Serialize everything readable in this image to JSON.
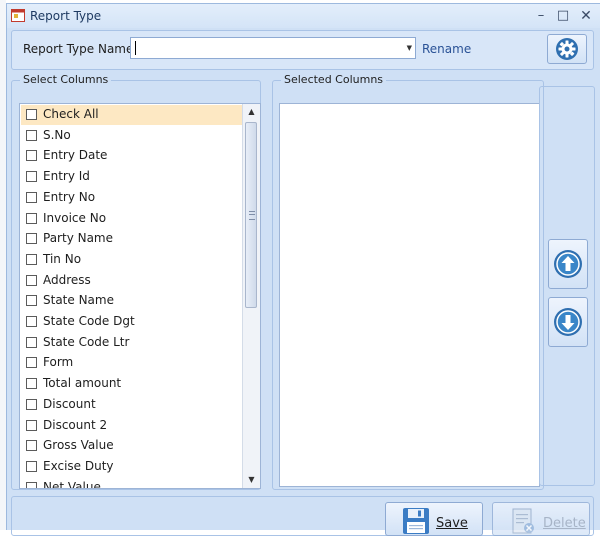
{
  "window": {
    "title": "Report Type"
  },
  "toolbar": {
    "report_type_label": "Report Type Name",
    "report_type_value": "",
    "rename_label": "Rename"
  },
  "icons": {
    "app": "app-window-icon",
    "settings": "gear-icon",
    "up": "arrow-up-circle-icon",
    "down": "arrow-down-circle-icon",
    "save": "floppy-disk-icon",
    "delete": "delete-document-icon"
  },
  "select_columns": {
    "title": "Select Columns",
    "items": [
      {
        "label": "Check All",
        "checked": false,
        "highlighted": true
      },
      {
        "label": "S.No",
        "checked": false
      },
      {
        "label": "Entry Date",
        "checked": false
      },
      {
        "label": "Entry Id",
        "checked": false
      },
      {
        "label": "Entry No",
        "checked": false
      },
      {
        "label": "Invoice No",
        "checked": false
      },
      {
        "label": "Party Name",
        "checked": false
      },
      {
        "label": "Tin No",
        "checked": false
      },
      {
        "label": "Address",
        "checked": false
      },
      {
        "label": "State Name",
        "checked": false
      },
      {
        "label": "State Code Dgt",
        "checked": false
      },
      {
        "label": "State Code Ltr",
        "checked": false
      },
      {
        "label": "Form",
        "checked": false
      },
      {
        "label": "Total amount",
        "checked": false
      },
      {
        "label": "Discount",
        "checked": false
      },
      {
        "label": "Discount 2",
        "checked": false
      },
      {
        "label": "Gross Value",
        "checked": false
      },
      {
        "label": "Excise Duty",
        "checked": false
      },
      {
        "label": "Net Value",
        "checked": false
      }
    ]
  },
  "selected_columns": {
    "title": "Selected Columns",
    "items": []
  },
  "actions": {
    "save_label": "Save",
    "delete_label": "Delete"
  },
  "colors": {
    "accent": "#2f6fb0",
    "highlight": "#fde8c3",
    "window_bg": "#cfe0f5"
  }
}
